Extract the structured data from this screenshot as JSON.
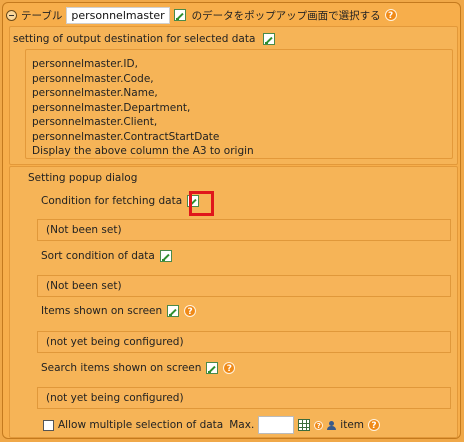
{
  "header": {
    "prefix": "テーブル",
    "table_name": "personnelmaster",
    "suffix": "のデータをポップアップ画面で選択する"
  },
  "output_destination": {
    "title": "setting of output destination for selected data",
    "lines": [
      "personnelmaster.ID,",
      "personnelmaster.Code,",
      "personnelmaster.Name,",
      "personnelmaster.Department,",
      "personnelmaster.Client,",
      "personnelmaster.ContractStartDate",
      "Display the above column the A3 to origin"
    ]
  },
  "popup": {
    "title": "Setting popup dialog",
    "condition": {
      "label": "Condition for fetching data",
      "value": "(Not been set)"
    },
    "sort": {
      "label": "Sort condition of data",
      "value": "(Not been set)"
    },
    "items": {
      "label": "Items shown on screen",
      "value": "(not yet being configured)"
    },
    "search": {
      "label": "Search items shown on screen",
      "value": "(not yet being configured)"
    },
    "multi": {
      "label": "Allow multiple selection of data",
      "max_label": "Max.",
      "max_value": "",
      "unit": "item"
    }
  },
  "icons": {
    "edit": "edit-icon",
    "help": "help-icon",
    "grid": "grid-icon",
    "person": "person-icon"
  },
  "colors": {
    "panel": "#f7ae4b",
    "border": "#c47a1e",
    "highlight": "#e0161b",
    "help": "#f08a18"
  }
}
